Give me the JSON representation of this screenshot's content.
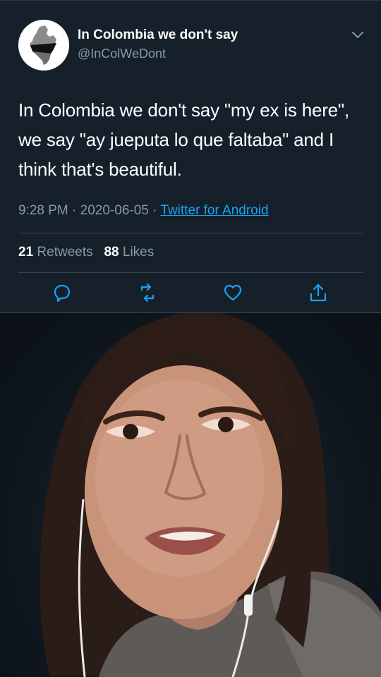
{
  "tweet": {
    "display_name": "In Colombia we don't say",
    "handle": "@InColWeDont",
    "text": "In Colombia we don't say \"my ex is here\", we say \"ay jueputa lo que faltaba\" and I think that's beautiful.",
    "time": "9:28 PM",
    "date": "2020-06-05",
    "separator": "·",
    "source": "Twitter for Android",
    "retweets_count": "21",
    "retweets_label": "Retweets",
    "likes_count": "88",
    "likes_label": "Likes"
  },
  "icons": {
    "avatar": "colombia-map-flag",
    "menu": "chevron-down-icon",
    "reply": "comment-icon",
    "retweet": "retweet-icon",
    "like": "heart-icon",
    "share": "share-icon"
  },
  "colors": {
    "background": "#15202b",
    "secondary_text": "#8899a6",
    "link": "#1da1f2",
    "divider": "#38444d",
    "action_icon": "#1da1f2"
  }
}
